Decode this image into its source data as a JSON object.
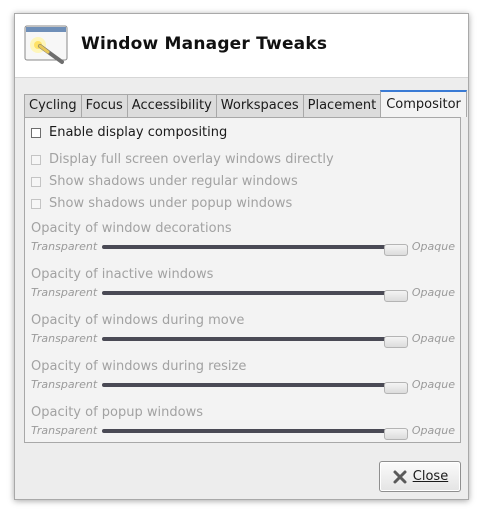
{
  "window": {
    "title": "Window Manager Tweaks",
    "icon": "tweaks-app-icon"
  },
  "tabs": [
    {
      "label": "Cycling",
      "active": false
    },
    {
      "label": "Focus",
      "active": false
    },
    {
      "label": "Accessibility",
      "active": false
    },
    {
      "label": "Workspaces",
      "active": false
    },
    {
      "label": "Placement",
      "active": false
    },
    {
      "label": "Compositor",
      "active": true
    }
  ],
  "compositor": {
    "enable_compositing": {
      "label": "Enable display compositing",
      "checked": false
    },
    "options": [
      {
        "label": "Display full screen overlay windows directly",
        "checked": false,
        "enabled": false
      },
      {
        "label": "Show shadows under regular windows",
        "checked": false,
        "enabled": false
      },
      {
        "label": "Show shadows under popup windows",
        "checked": false,
        "enabled": false
      }
    ],
    "sliders": [
      {
        "label": "Opacity of window decorations",
        "min_label": "Transparent",
        "max_label": "Opaque",
        "value": 1.0
      },
      {
        "label": "Opacity of inactive windows",
        "min_label": "Transparent",
        "max_label": "Opaque",
        "value": 1.0
      },
      {
        "label": "Opacity of windows during move",
        "min_label": "Transparent",
        "max_label": "Opaque",
        "value": 1.0
      },
      {
        "label": "Opacity of windows during resize",
        "min_label": "Transparent",
        "max_label": "Opaque",
        "value": 1.0
      },
      {
        "label": "Opacity of popup windows",
        "min_label": "Transparent",
        "max_label": "Opaque",
        "value": 1.0
      }
    ]
  },
  "footer": {
    "close_label": "Close",
    "close_icon": "close-x-icon"
  },
  "colors": {
    "active_tab_accent": "#3a7bd5",
    "slider_track": "#4a4a55",
    "disabled_text": "#a2a2a2"
  }
}
